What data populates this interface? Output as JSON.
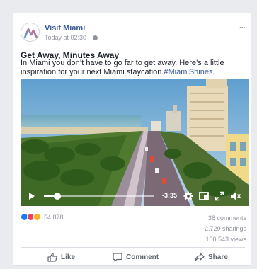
{
  "post": {
    "page_name": "Visit Miami",
    "timestamp": "Today at 02:30 ·",
    "headline": "Get Away, Minutes Away",
    "body": "In Miami you don’t have to go far to get away. Here’s a little inspiration for your next Miami staycation.",
    "hashtag": "#MiamiShines."
  },
  "video": {
    "time_remaining": "-3:35",
    "progress_percent": 12
  },
  "engagement": {
    "reaction_count": "54.878",
    "comments": "38 comments",
    "sharings": "2.729 sharings",
    "views": "100.543 views"
  },
  "actions": {
    "like": "Like",
    "comment": "Comment",
    "share": "Share"
  },
  "colors": {
    "link": "#385898",
    "like_blue": "#1877f2",
    "love_red": "#f33e58",
    "wow_yellow": "#f7b125"
  },
  "icons": [
    "more-icon",
    "globe-icon",
    "play-icon",
    "settings-icon",
    "theater-mode-icon",
    "fullscreen-icon",
    "volume-icon",
    "like-icon",
    "comment-icon",
    "share-icon"
  ]
}
